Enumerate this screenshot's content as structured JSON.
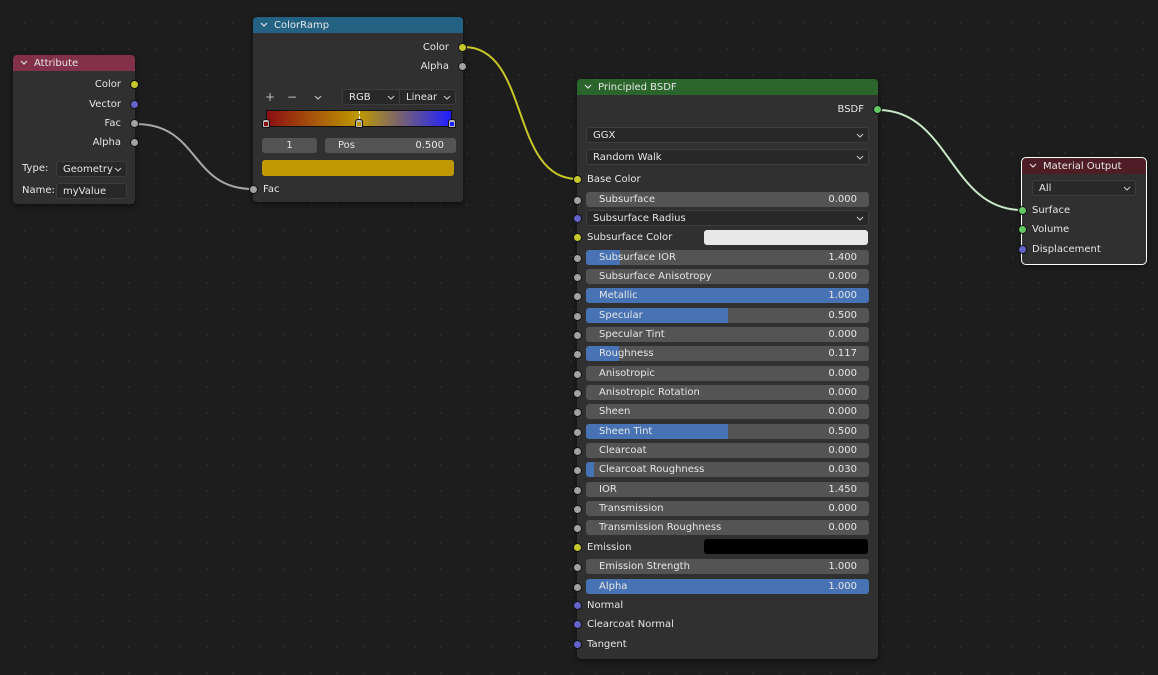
{
  "colors": {
    "attribute_header": "#83314a",
    "colorramp_header": "#246283",
    "bsdf_header": "#2b652b",
    "output_header": "#4e1d26",
    "socket_color": "#c7c729",
    "socket_vector": "#6363c7",
    "socket_float": "#a1a1a1",
    "socket_shader": "#63c763",
    "slider_fill": "#4772b3",
    "ramp_selected_color": "#bf9900",
    "subsurface_color": "#e8e8e8",
    "emission_color": "#000000"
  },
  "attribute_node": {
    "title": "Attribute",
    "outputs": [
      "Color",
      "Vector",
      "Fac",
      "Alpha"
    ],
    "type_label": "Type:",
    "type_value": "Geometry",
    "name_label": "Name:",
    "name_value": "myValue"
  },
  "colorramp_node": {
    "title": "ColorRamp",
    "outputs": [
      "Color",
      "Alpha"
    ],
    "add_icon": "+",
    "remove_icon": "−",
    "color_mode": "RGB",
    "interpolation": "Linear",
    "stops": [
      {
        "position": 0.0,
        "color": "#8c0f14"
      },
      {
        "position": 0.5,
        "color": "#bf9900"
      },
      {
        "position": 1.0,
        "color": "#1f1fff"
      }
    ],
    "active_index": "1",
    "pos_label": "Pos",
    "pos_value": "0.500",
    "input": "Fac"
  },
  "bsdf_node": {
    "title": "Principled BSDF",
    "output": "BSDF",
    "distribution": "GGX",
    "subsurface_method": "Random Walk",
    "base_color_label": "Base Color",
    "subsurface_radius_label": "Subsurface Radius",
    "subsurface_color_label": "Subsurface Color",
    "emission_label": "Emission",
    "fields": [
      {
        "label": "Subsurface",
        "value": "0.000",
        "fill": 0
      },
      {
        "label": "Subsurface IOR",
        "value": "1.400",
        "fill": 0.12
      },
      {
        "label": "Subsurface Anisotropy",
        "value": "0.000",
        "fill": 0
      },
      {
        "label": "Metallic",
        "value": "1.000",
        "fill": 1
      },
      {
        "label": "Specular",
        "value": "0.500",
        "fill": 0.5
      },
      {
        "label": "Specular Tint",
        "value": "0.000",
        "fill": 0
      },
      {
        "label": "Roughness",
        "value": "0.117",
        "fill": 0.117
      },
      {
        "label": "Anisotropic",
        "value": "0.000",
        "fill": 0
      },
      {
        "label": "Anisotropic Rotation",
        "value": "0.000",
        "fill": 0
      },
      {
        "label": "Sheen",
        "value": "0.000",
        "fill": 0
      },
      {
        "label": "Sheen Tint",
        "value": "0.500",
        "fill": 0.5
      },
      {
        "label": "Clearcoat",
        "value": "0.000",
        "fill": 0
      },
      {
        "label": "Clearcoat Roughness",
        "value": "0.030",
        "fill": 0.03
      },
      {
        "label": "IOR",
        "value": "1.450",
        "fill": 0
      },
      {
        "label": "Transmission",
        "value": "0.000",
        "fill": 0
      },
      {
        "label": "Transmission Roughness",
        "value": "0.000",
        "fill": 0
      },
      {
        "label": "Emission Strength",
        "value": "1.000",
        "fill": 0
      },
      {
        "label": "Alpha",
        "value": "1.000",
        "fill": 1
      }
    ],
    "vector_inputs": [
      "Normal",
      "Clearcoat Normal",
      "Tangent"
    ]
  },
  "output_node": {
    "title": "Material Output",
    "target": "All",
    "inputs": [
      "Surface",
      "Volume",
      "Displacement"
    ]
  }
}
